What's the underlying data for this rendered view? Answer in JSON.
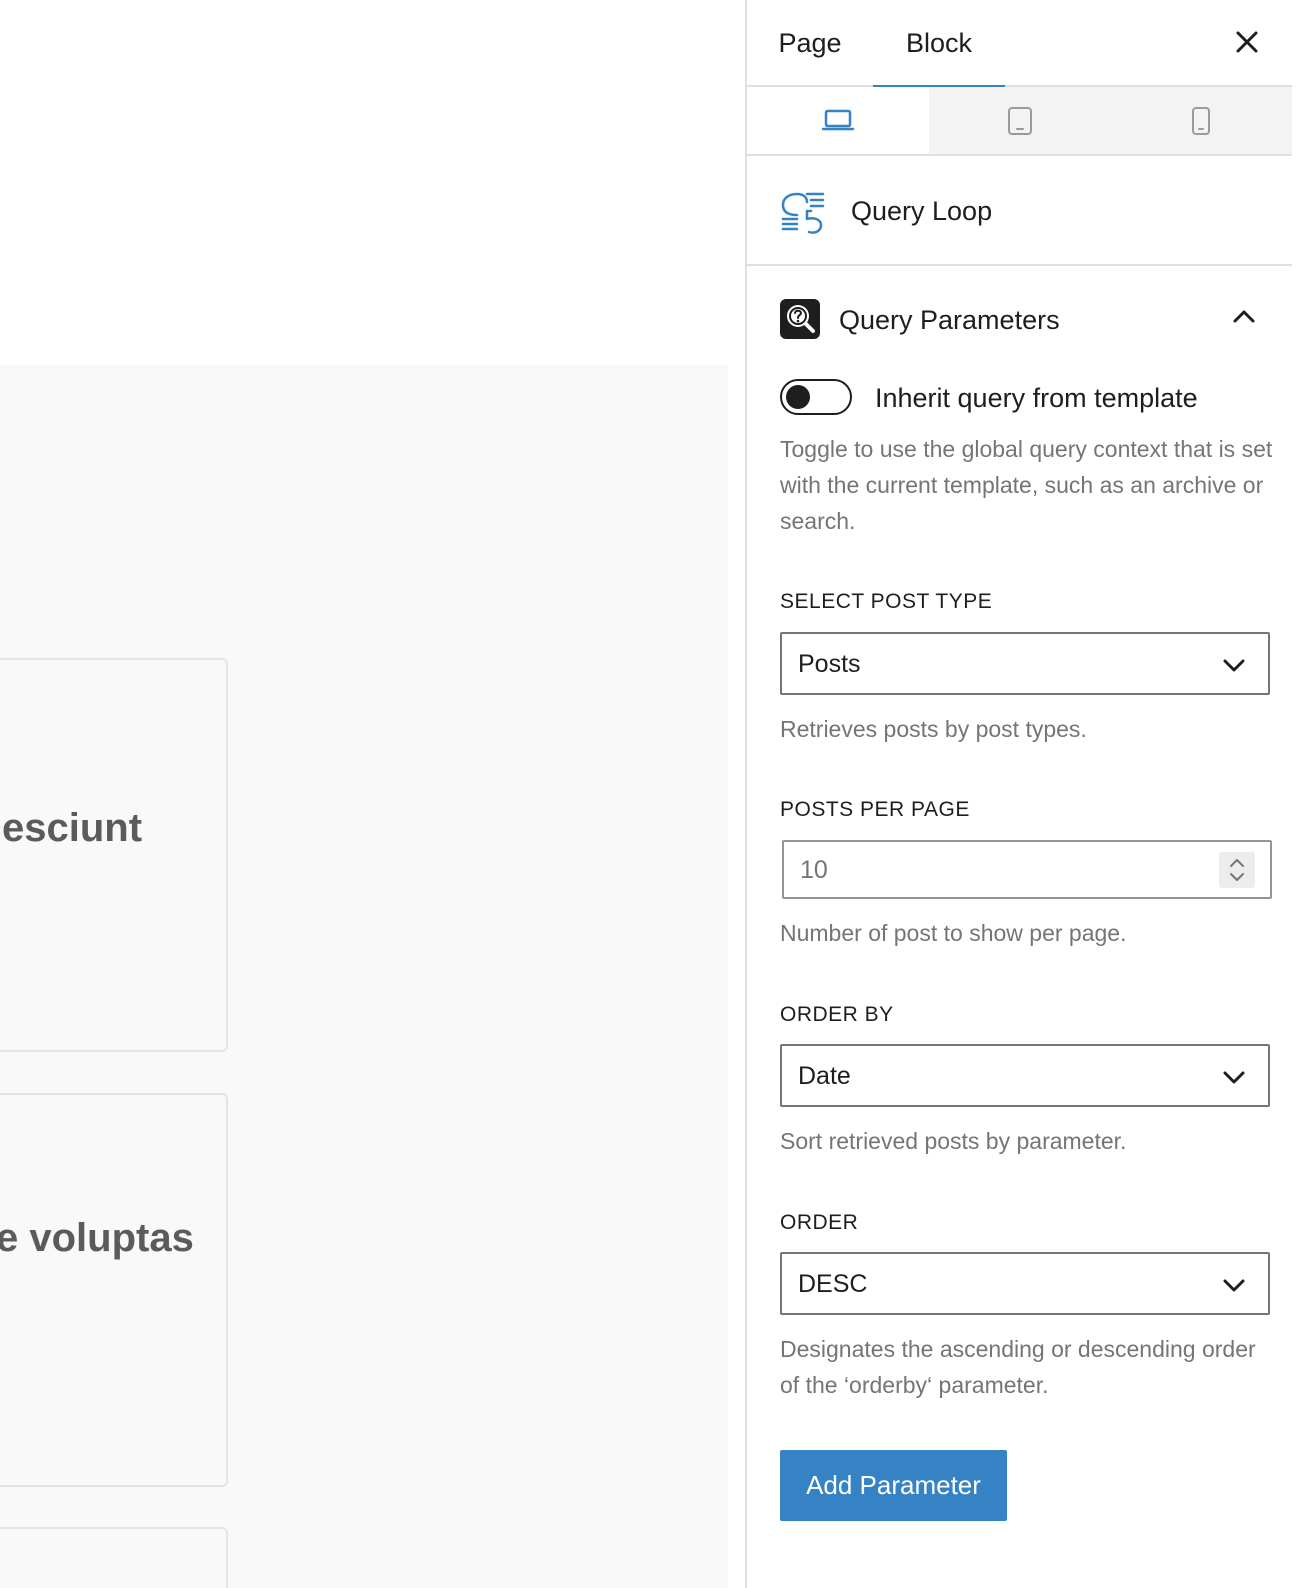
{
  "canvas": {
    "cards": [
      {
        "text": "esciunt"
      },
      {
        "text": "e voluptas"
      },
      {
        "text": ""
      }
    ]
  },
  "sidebar": {
    "tabs": [
      {
        "label": "Page",
        "active": false
      },
      {
        "label": "Block",
        "active": true
      }
    ],
    "devices": [
      {
        "name": "desktop-icon",
        "active": true
      },
      {
        "name": "tablet-icon",
        "active": false
      },
      {
        "name": "mobile-icon",
        "active": false
      }
    ],
    "block": {
      "title": "Query Loop",
      "icon": "query-loop-icon"
    },
    "panel": {
      "title": "Query Parameters",
      "icon": "query-search-icon",
      "expanded": true,
      "toggle": {
        "label": "Inherit query from template",
        "checked": false,
        "help": "Toggle to use the global query context that is set with the current template, such as an archive or search."
      },
      "post_type": {
        "label": "SELECT POST TYPE",
        "value": "Posts",
        "help": "Retrieves posts by post types."
      },
      "posts_per_page": {
        "label": "POSTS PER PAGE",
        "value": "10",
        "help": "Number of post to show per page."
      },
      "order_by": {
        "label": "ORDER BY",
        "value": "Date",
        "help": "Sort retrieved posts by parameter."
      },
      "order": {
        "label": "ORDER",
        "value": "DESC",
        "help": "Designates the ascending or descending order of the ‘orderby‘ parameter."
      },
      "add_button": "Add Parameter"
    }
  },
  "colors": {
    "accent": "#3582c4",
    "text": "#1e1e1e",
    "muted": "#757575",
    "border": "#e0e0e0"
  }
}
